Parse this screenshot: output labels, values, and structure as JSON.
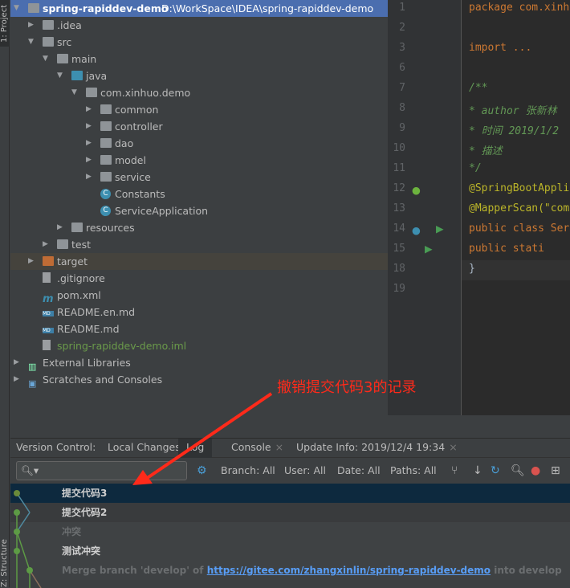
{
  "left_strip": {
    "project_tab": "1: Project",
    "structure_tab": "Z: Structure"
  },
  "tree": {
    "items": [
      {
        "label": "spring-rapiddev-demo",
        "path": "D:\\WorkSpace\\IDEA\\spring-rapiddev-demo",
        "level": 0,
        "state": "open",
        "icon": "project-folder-icon"
      },
      {
        "label": ".idea",
        "level": 1,
        "state": "closed",
        "icon": "folder-icon"
      },
      {
        "label": "src",
        "level": 1,
        "state": "open",
        "icon": "folder-icon"
      },
      {
        "label": "main",
        "level": 2,
        "state": "open",
        "icon": "folder-icon"
      },
      {
        "label": "java",
        "level": 3,
        "state": "open",
        "icon": "source-folder-icon"
      },
      {
        "label": "com.xinhuo.demo",
        "level": 4,
        "state": "open",
        "icon": "package-icon"
      },
      {
        "label": "common",
        "level": 5,
        "state": "closed",
        "icon": "package-icon"
      },
      {
        "label": "controller",
        "level": 5,
        "state": "closed",
        "icon": "package-icon"
      },
      {
        "label": "dao",
        "level": 5,
        "state": "closed",
        "icon": "package-icon"
      },
      {
        "label": "model",
        "level": 5,
        "state": "closed",
        "icon": "package-icon"
      },
      {
        "label": "service",
        "level": 5,
        "state": "closed",
        "icon": "package-icon"
      },
      {
        "label": "Constants",
        "level": 5,
        "state": "none",
        "icon": "class-icon"
      },
      {
        "label": "ServiceApplication",
        "level": 5,
        "state": "none",
        "icon": "spring-class-icon"
      },
      {
        "label": "resources",
        "level": 3,
        "state": "closed",
        "icon": "folder-icon"
      },
      {
        "label": "test",
        "level": 2,
        "state": "closed",
        "icon": "folder-icon"
      },
      {
        "label": "target",
        "level": 1,
        "state": "closed",
        "icon": "excluded-folder-icon"
      },
      {
        "label": ".gitignore",
        "level": 1,
        "state": "none",
        "icon": "text-file-icon"
      },
      {
        "label": "pom.xml",
        "level": 1,
        "state": "none",
        "icon": "maven-icon"
      },
      {
        "label": "README.en.md",
        "level": 1,
        "state": "none",
        "icon": "markdown-icon"
      },
      {
        "label": "README.md",
        "level": 1,
        "state": "none",
        "icon": "markdown-icon"
      },
      {
        "label": "spring-rapiddev-demo.iml",
        "level": 1,
        "state": "none",
        "icon": "iml-file-icon"
      },
      {
        "label": "External Libraries",
        "level": 0,
        "state": "closed",
        "icon": "libraries-icon"
      },
      {
        "label": "Scratches and Consoles",
        "level": 0,
        "state": "closed",
        "icon": "scratches-icon"
      }
    ]
  },
  "editor": {
    "lines": [
      {
        "n": "1",
        "code": "package com.xinh"
      },
      {
        "n": "2",
        "code": ""
      },
      {
        "n": "3",
        "code": "import ..."
      },
      {
        "n": "6",
        "code": ""
      },
      {
        "n": "7",
        "code": "/**"
      },
      {
        "n": "8",
        "code": " * author 张新林"
      },
      {
        "n": "9",
        "code": " * 时间 2019/1/2"
      },
      {
        "n": "10",
        "code": " * 描述"
      },
      {
        "n": "11",
        "code": " */"
      },
      {
        "n": "12",
        "code": "@SpringBootAppli"
      },
      {
        "n": "13",
        "code": "@MapperScan(\"com"
      },
      {
        "n": "14",
        "code": "public class Ser"
      },
      {
        "n": "15",
        "code": "    public stati"
      },
      {
        "n": "18",
        "code": "}"
      },
      {
        "n": "19",
        "code": ""
      }
    ]
  },
  "vcs": {
    "tabs": [
      {
        "label": "Version Control:"
      },
      {
        "label": "Local Changes"
      },
      {
        "label": "Log",
        "active": true
      },
      {
        "label": "Console",
        "closable": true
      },
      {
        "label": "Update Info: 2019/12/4 19:34",
        "closable": true
      }
    ],
    "search_placeholder": "",
    "filters": [
      "Branch: All",
      "User: All",
      "Date: All",
      "Paths: All"
    ],
    "commits": [
      {
        "message": "提交代码3",
        "selected": true
      },
      {
        "message": "提交代码2"
      },
      {
        "message": "冲突",
        "dim": true
      },
      {
        "message": "测试冲突"
      },
      {
        "message_prefix": "Merge branch 'develop' of ",
        "link": "https://gitee.com/zhangxinlin/spring-rapiddev-demo",
        "message_suffix": " into develop",
        "dim": true
      }
    ]
  },
  "annotation": {
    "text": "撤销提交代码3的记录",
    "color": "#ff2a1a"
  }
}
